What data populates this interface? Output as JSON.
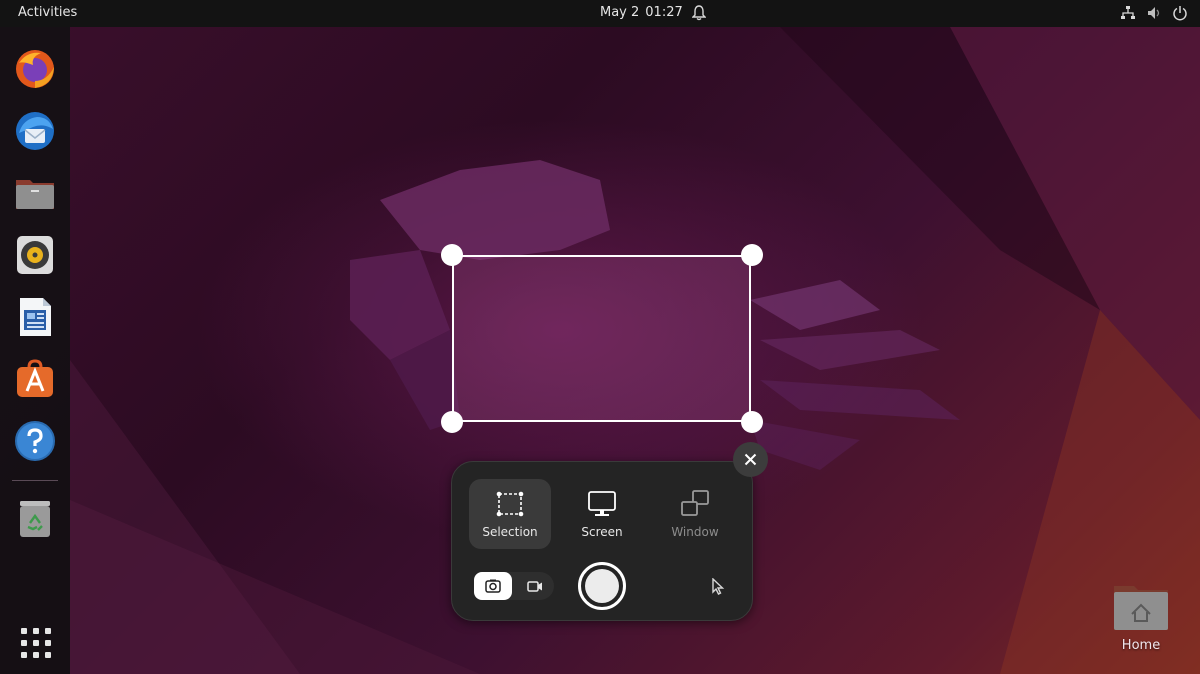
{
  "topbar": {
    "activities_label": "Activities",
    "date": "May 2",
    "time": "01:27",
    "icons": [
      "notification-bell-icon",
      "network-icon",
      "volume-muted-icon",
      "power-icon"
    ]
  },
  "dock": {
    "items": [
      {
        "name": "firefox",
        "icon": "firefox-icon"
      },
      {
        "name": "thunderbird",
        "icon": "thunderbird-icon"
      },
      {
        "name": "files",
        "icon": "files-icon"
      },
      {
        "name": "rhythmbox",
        "icon": "rhythmbox-icon"
      },
      {
        "name": "libreoffice-writer",
        "icon": "writer-icon"
      },
      {
        "name": "app-center",
        "icon": "app-center-icon"
      },
      {
        "name": "help",
        "icon": "help-icon"
      },
      {
        "name": "trash",
        "icon": "trash-icon"
      },
      {
        "name": "show-apps",
        "icon": "apps-grid-icon"
      }
    ]
  },
  "screenshot_ui": {
    "modes": [
      {
        "label": "Selection",
        "active": true
      },
      {
        "label": "Screen",
        "active": false
      },
      {
        "label": "Window",
        "active": false
      }
    ],
    "capture_type": "photo",
    "show_pointer": false
  },
  "desktop": {
    "home_label": "Home"
  },
  "colors": {
    "topbar_bg": "#131313",
    "panel_bg": "#242424",
    "active_mode_bg": "#3a3a3a",
    "wallpaper_accent": "#7a2a5c"
  }
}
